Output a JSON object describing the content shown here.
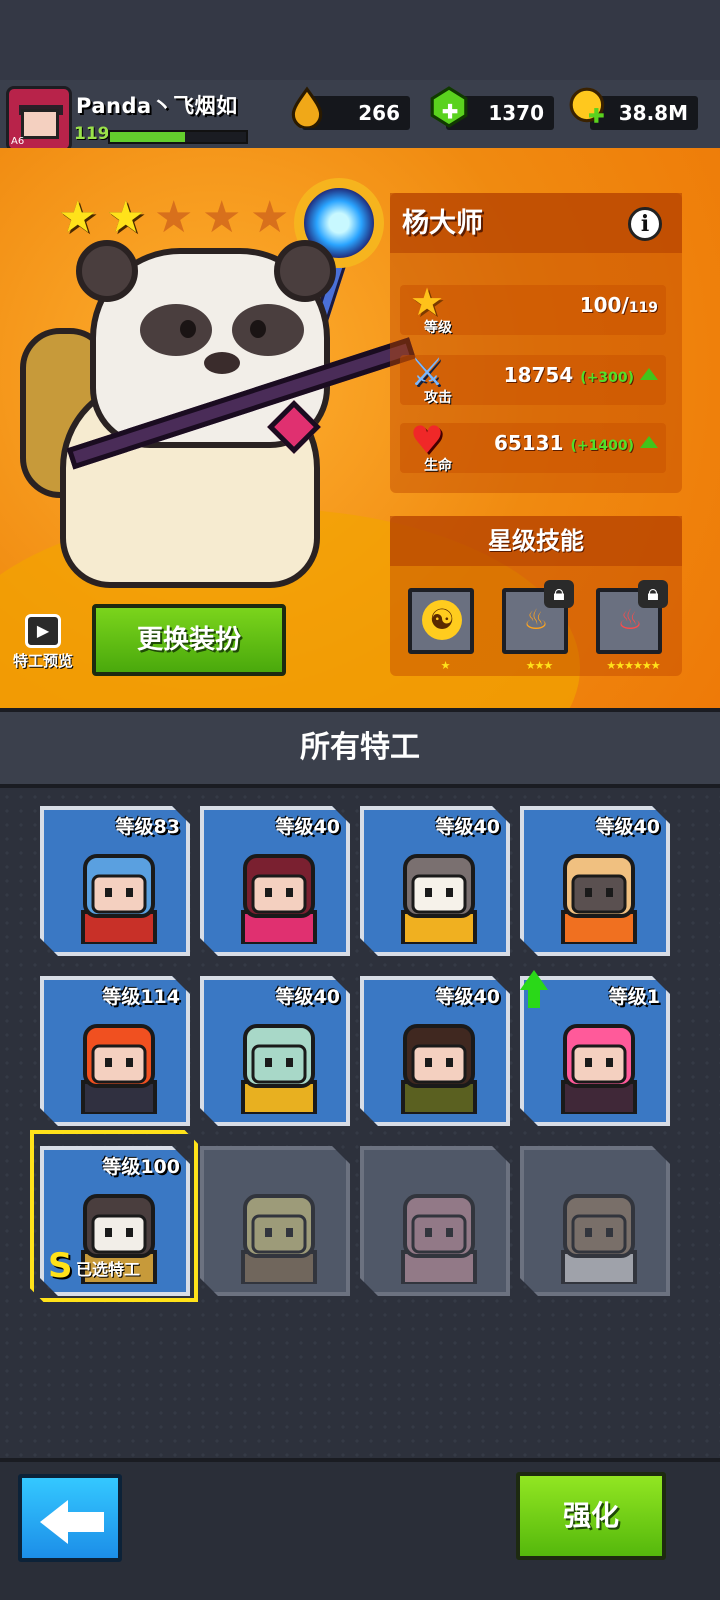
{
  "player": {
    "name": "Panda丶飞烟如",
    "level": "119",
    "level_progress": 0.55,
    "avatar_badge": "A6"
  },
  "resources": [
    {
      "icon": "energy-drop-icon",
      "value": "266"
    },
    {
      "icon": "green-gem-icon",
      "value": "1370"
    },
    {
      "icon": "gold-coin-icon",
      "value": "38.8M"
    }
  ],
  "hero": {
    "stars_filled": 2,
    "stars_total": 6,
    "name": "杨大师",
    "info_label": "i",
    "stats": {
      "level_label": "等级",
      "level_value": "100/",
      "level_max": "119",
      "attack_label": "攻击",
      "attack_value": "18754",
      "attack_bonus": "(+300)",
      "hp_label": "生命",
      "hp_value": "65131",
      "hp_bonus": "(+1400)"
    }
  },
  "skills": {
    "title": "星级技能",
    "items": [
      {
        "icon": "yin-yang-icon",
        "stars": "★",
        "locked": false
      },
      {
        "icon": "flame-icon",
        "stars": "★★★",
        "locked": true
      },
      {
        "icon": "fire-demon-icon",
        "stars": "★★★★★★",
        "locked": true
      }
    ]
  },
  "preview_label": "特工预览",
  "dress_button": "更换装扮",
  "section_title": "所有特工",
  "agents": [
    {
      "level": "等级83",
      "portrait": "goggles-agent",
      "color": "#3a78c4"
    },
    {
      "level": "等级40",
      "portrait": "pink-ninja-agent",
      "color": "#3a78c4"
    },
    {
      "level": "等级40",
      "portrait": "cat-agent",
      "color": "#3a78c4"
    },
    {
      "level": "等级40",
      "portrait": "robot-agent",
      "color": "#3a78c4"
    },
    {
      "level": "等级114",
      "portrait": "redhead-agent",
      "color": "#3a78c4"
    },
    {
      "level": "等级40",
      "portrait": "squidward-agent",
      "color": "#3a78c4"
    },
    {
      "level": "等级40",
      "portrait": "soldier-agent",
      "color": "#3a78c4"
    },
    {
      "level": "等级1",
      "portrait": "pink-hair-agent",
      "color": "#3a78c4"
    },
    {
      "level": "等级100",
      "portrait": "panda-agent",
      "color": "#3a78c4"
    },
    {
      "level": "",
      "portrait": "spongebob-agent",
      "color": "#505868"
    },
    {
      "level": "",
      "portrait": "patrick-agent",
      "color": "#505868"
    },
    {
      "level": "",
      "portrait": "sandy-agent",
      "color": "#505868"
    }
  ],
  "selected": {
    "rank": "S",
    "label": "已选特工"
  },
  "back_icon": "back-arrow-icon",
  "strengthen_button": "强化"
}
